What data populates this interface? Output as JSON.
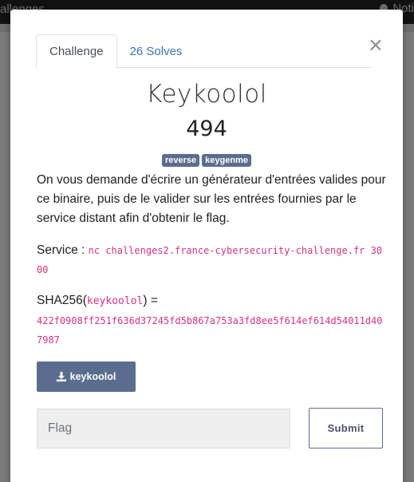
{
  "background": {
    "topbar_left_text": "allenges",
    "topbar_right_text": "Noti"
  },
  "modal": {
    "close_symbol": "×",
    "tabs": [
      {
        "label": "Challenge",
        "active": true
      },
      {
        "label": "26 Solves",
        "active": false
      }
    ],
    "title": "Keykoolol",
    "points": "494",
    "tags": [
      "reverse",
      "keygenme"
    ],
    "description": "On vous demande d'écrire un générateur d'entrées valides pour ce binaire, puis de le valider sur les entrées fournies par le service distant afin d'obtenir le flag.",
    "service": {
      "label": "Service : ",
      "command": "nc challenges2.france-cybersecurity-challenge.fr 3000"
    },
    "sha": {
      "prefix": "SHA256(",
      "filename": "keykoolol",
      "suffix": ") =",
      "hash": "422f0908ff251f636d37245fd5b867a753a3fd8ee5f614ef614d54011d407987"
    },
    "download": {
      "icon": "download-icon",
      "label": "keykoolol"
    },
    "flag_input": {
      "placeholder": "Flag",
      "value": ""
    },
    "submit_label": "Submit"
  },
  "colors": {
    "accent": "#5b6d8e",
    "link": "#3a73b8",
    "code": "#d63384"
  }
}
